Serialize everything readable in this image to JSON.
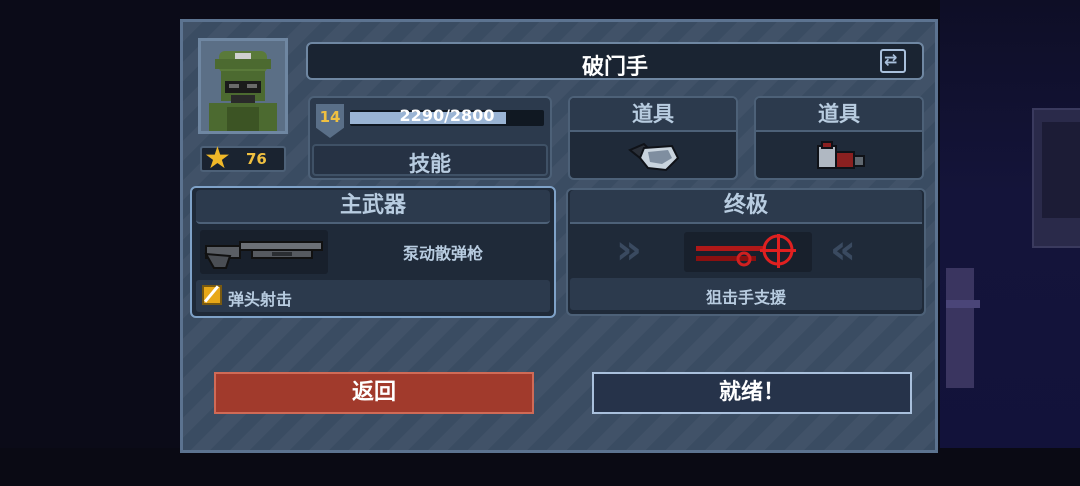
{
  "character": {
    "name": "破门手",
    "stars": "76",
    "level": "14",
    "xp_text": "2290/2800",
    "xp_fraction": 0.818,
    "skill_label": "技能"
  },
  "items": [
    {
      "label": "道具",
      "icon": "grenade-icon"
    },
    {
      "label": "道具",
      "icon": "breaching-charge-icon"
    }
  ],
  "primary_weapon": {
    "header": "主武器",
    "name": "泵动散弹枪",
    "perk": "弹头射击",
    "icon": "shotgun-icon"
  },
  "ultimate": {
    "header": "终极",
    "name": "狙击手支援",
    "icon": "sniper-crosshair-icon"
  },
  "buttons": {
    "back": "返回",
    "ready": "就绪！"
  },
  "colors": {
    "back_button": "#a13a2c",
    "xp_fill": "#9ab4d4",
    "level_text": "#f0c040"
  }
}
